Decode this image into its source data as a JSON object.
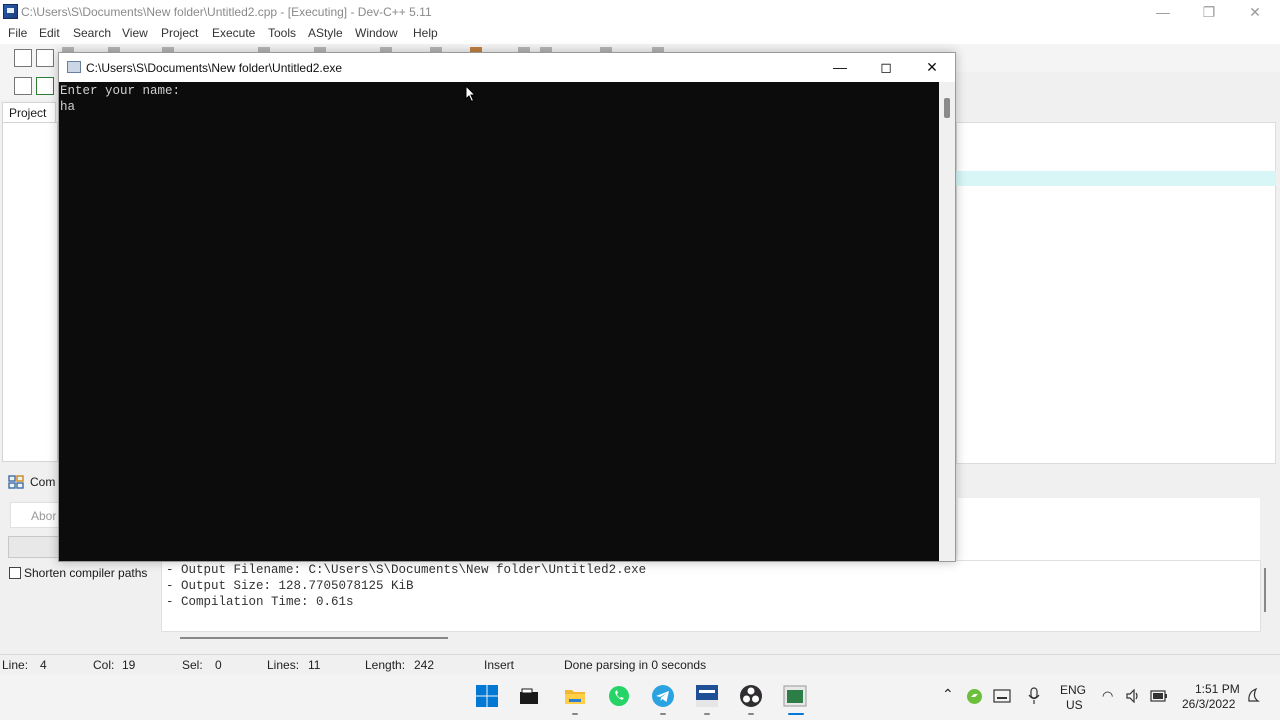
{
  "window": {
    "title": "C:\\Users\\S\\Documents\\New folder\\Untitled2.cpp - [Executing] - Dev-C++ 5.11"
  },
  "menu": [
    "File",
    "Edit",
    "Search",
    "View",
    "Project",
    "Execute",
    "Tools",
    "AStyle",
    "Window",
    "Help"
  ],
  "left_panel": {
    "project_tab": "Project"
  },
  "console": {
    "title": "C:\\Users\\S\\Documents\\New folder\\Untitled2.exe",
    "output": [
      "Enter your name:",
      "ha"
    ]
  },
  "compiler": {
    "tab_label": "Com",
    "abort_label": "Abor",
    "shorten_label": "Shorten compiler paths",
    "log": [
      "- Output Filename: C:\\Users\\S\\Documents\\New folder\\Untitled2.exe",
      "- Output Size: 128.7705078125 KiB",
      "- Compilation Time: 0.61s"
    ]
  },
  "status": {
    "line_label": "Line:",
    "line_value": "4",
    "col_label": "Col:",
    "col_value": "19",
    "sel_label": "Sel:",
    "sel_value": "0",
    "lines_label": "Lines:",
    "lines_value": "11",
    "length_label": "Length:",
    "length_value": "242",
    "mode": "Insert",
    "message": "Done parsing in 0 seconds"
  },
  "taskbar": {
    "apps": [
      "start-icon",
      "file-explorer-icon",
      "folder-icon",
      "whatsapp-icon",
      "telegram-icon",
      "devcpp-icon",
      "obs-icon",
      "console-app-icon"
    ],
    "lang_top": "ENG",
    "lang_bottom": "US",
    "time": "1:51 PM",
    "date": "26/3/2022"
  },
  "colors": {
    "console_bg": "#0c0c0c",
    "editor_highlight": "#d8f6f6",
    "windows_blue": "#0078d4"
  }
}
